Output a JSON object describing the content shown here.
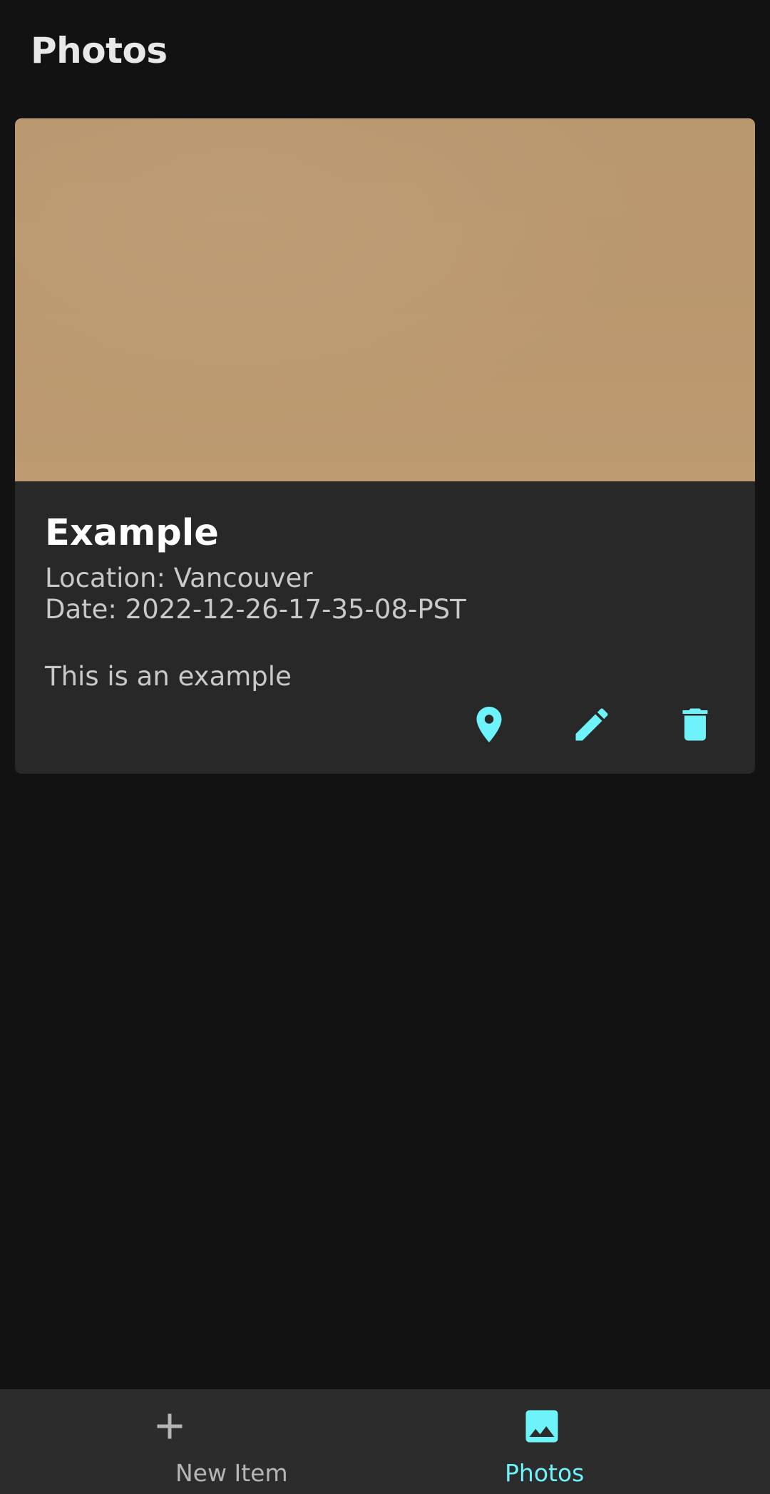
{
  "header": {
    "title": "Photos"
  },
  "card": {
    "title": "Example",
    "location": "Location: Vancouver",
    "date": "Date: 2022-12-26-17-35-08-PST",
    "description": "This is an example",
    "image_color": "#bb986f",
    "actions": [
      {
        "icon": "map-pin-icon"
      },
      {
        "icon": "pencil-icon"
      },
      {
        "icon": "trash-icon"
      }
    ]
  },
  "bottom_nav": {
    "items": [
      {
        "label": "New Item",
        "icon": "plus-icon",
        "active": false
      },
      {
        "label": "Photos",
        "icon": "image-icon",
        "active": true
      }
    ]
  },
  "colors": {
    "background": "#121212",
    "surface": "#282828",
    "accent": "#6ef3fb",
    "nav_background": "#2c2c2c"
  }
}
